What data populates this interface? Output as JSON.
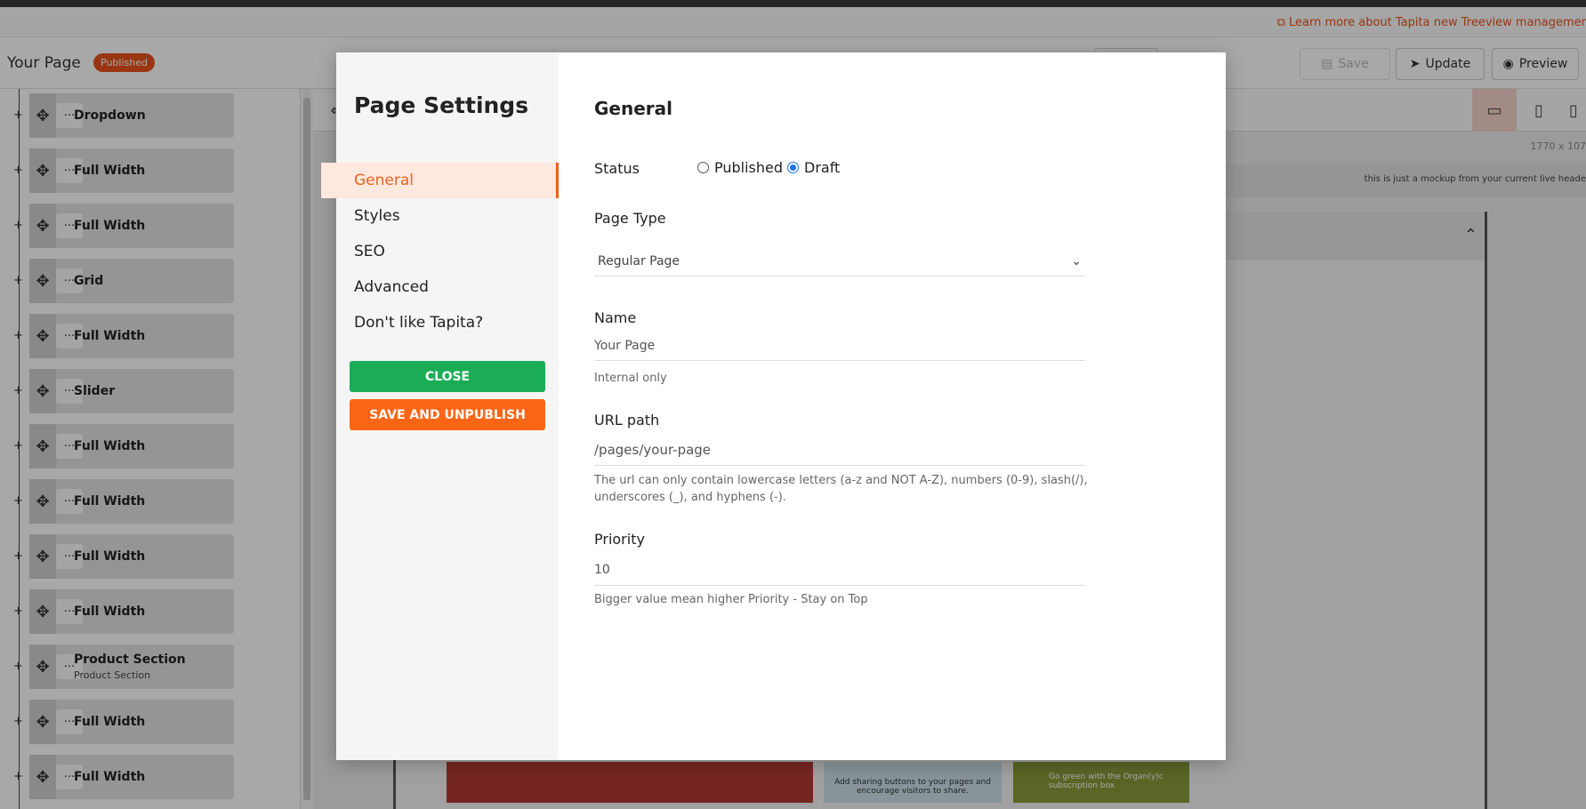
{
  "topbar": {
    "learn_more": "Learn more about Tapita new Treeview managemer"
  },
  "header": {
    "page_name": "Your Page",
    "status_badge": "Published",
    "save_label": "Save",
    "update_label": "Update",
    "preview_label": "Preview"
  },
  "tree": {
    "items": [
      {
        "label": "Dropdown",
        "sub": ""
      },
      {
        "label": "Full Width",
        "sub": ""
      },
      {
        "label": "Full Width",
        "sub": ""
      },
      {
        "label": "Grid",
        "sub": ""
      },
      {
        "label": "Full Width",
        "sub": ""
      },
      {
        "label": "Slider",
        "sub": ""
      },
      {
        "label": "Full Width",
        "sub": ""
      },
      {
        "label": "Full Width",
        "sub": ""
      },
      {
        "label": "Full Width",
        "sub": ""
      },
      {
        "label": "Full Width",
        "sub": ""
      },
      {
        "label": "Product Section",
        "sub": "Product Section"
      },
      {
        "label": "Full Width",
        "sub": ""
      },
      {
        "label": "Full Width",
        "sub": ""
      }
    ],
    "more_glyph": "···"
  },
  "canvas": {
    "size_readout": "1770 x 107",
    "mock_note": "this is just a mockup from your current live heade",
    "tile_sharing": "Add sharing buttons to your pages and encourage visitors to share.",
    "tile_organic": "Go green with the Organ(y)c subscription box"
  },
  "modal": {
    "title": "Page Settings",
    "nav": [
      {
        "label": "General",
        "active": true
      },
      {
        "label": "Styles",
        "active": false
      },
      {
        "label": "SEO",
        "active": false
      },
      {
        "label": "Advanced",
        "active": false
      },
      {
        "label": "Don't like Tapita?",
        "active": false
      }
    ],
    "close_label": "CLOSE",
    "unpublish_label": "SAVE AND UNPUBLISH",
    "section_heading": "General",
    "status": {
      "label": "Status",
      "options": [
        "Published",
        "Draft"
      ],
      "selected": "Draft"
    },
    "page_type": {
      "label": "Page Type",
      "value": "Regular Page"
    },
    "name": {
      "label": "Name",
      "value": "Your Page",
      "hint": "Internal only"
    },
    "url_path": {
      "label": "URL path",
      "value": "/pages/your-page",
      "hint": "The url can only contain lowercase letters (a-z and NOT A-Z), numbers (0-9), slash(/), underscores (_), and hyphens (-)."
    },
    "priority": {
      "label": "Priority",
      "value": "10",
      "hint": "Bigger value mean higher Priority - Stay on Top"
    }
  },
  "colors": {
    "accent": "#e8621e",
    "close": "#1aad56",
    "unpublish": "#fb6616",
    "radio": "#1b73e8"
  }
}
